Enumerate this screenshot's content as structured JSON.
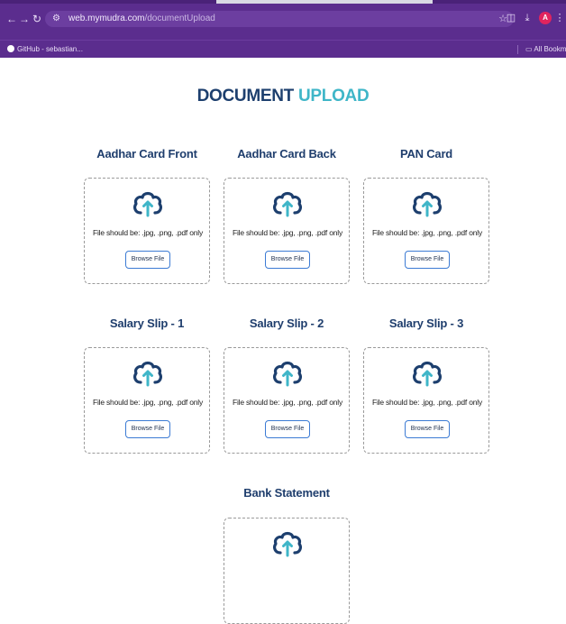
{
  "browser": {
    "url_domain": "web.mymudra.com",
    "url_path": "/documentUpload",
    "bookmark_item": "GitHub - sebastian...",
    "all_bookmarks": "All Bookmarks",
    "profile_initial": "A"
  },
  "page": {
    "title_part1": "DOCUMENT",
    "title_part2": "UPLOAD"
  },
  "cards": [
    {
      "label": "Aadhar Card Front",
      "hint": "File should be: .jpg, .png, .pdf only",
      "button": "Browse File"
    },
    {
      "label": "Aadhar Card Back",
      "hint": "File should be: .jpg, .png, .pdf only",
      "button": "Browse File"
    },
    {
      "label": "PAN Card",
      "hint": "File should be: .jpg, .png, .pdf only",
      "button": "Browse File"
    },
    {
      "label": "Salary Slip - 1",
      "hint": "File should be: .jpg, .png, .pdf only",
      "button": "Browse File"
    },
    {
      "label": "Salary Slip - 2",
      "hint": "File should be: .jpg, .png, .pdf only",
      "button": "Browse File"
    },
    {
      "label": "Salary Slip - 3",
      "hint": "File should be: .jpg, .png, .pdf only",
      "button": "Browse File"
    },
    {
      "label": "Bank Statement",
      "hint": "",
      "button": ""
    }
  ],
  "colors": {
    "chrome": "#5b2d8e",
    "title_dark": "#1d3f6e",
    "title_accent": "#3fb6c8",
    "cloud": "#1d3f6e",
    "arrow": "#3fb6c8"
  },
  "icons": [
    "cloud-upload-icon"
  ]
}
